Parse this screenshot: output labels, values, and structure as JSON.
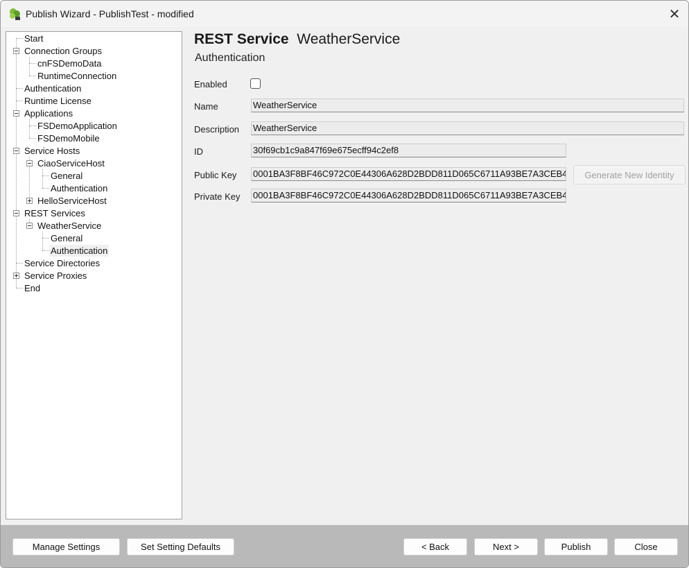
{
  "window": {
    "title": "Publish Wizard - PublishTest - modified",
    "close_glyph": "✕"
  },
  "tree": {
    "items": [
      {
        "label": "Start"
      },
      {
        "label": "Connection Groups"
      },
      {
        "label": "cnFSDemoData"
      },
      {
        "label": "RuntimeConnection"
      },
      {
        "label": "Authentication"
      },
      {
        "label": "Runtime License"
      },
      {
        "label": "Applications"
      },
      {
        "label": "FSDemoApplication"
      },
      {
        "label": "FSDemoMobile"
      },
      {
        "label": "Service Hosts"
      },
      {
        "label": "CiaoServiceHost"
      },
      {
        "label": "General"
      },
      {
        "label": "Authentication"
      },
      {
        "label": "HelloServiceHost"
      },
      {
        "label": "REST Services"
      },
      {
        "label": "WeatherService"
      },
      {
        "label": "General"
      },
      {
        "label": "Authentication"
      },
      {
        "label": "Service Directories"
      },
      {
        "label": "Service Proxies"
      },
      {
        "label": "End"
      }
    ],
    "selected": "Authentication"
  },
  "header": {
    "type": "REST Service",
    "name": "WeatherService",
    "subtitle": "Authentication"
  },
  "form": {
    "enabled_label": "Enabled",
    "name_label": "Name",
    "name_value": "WeatherService",
    "description_label": "Description",
    "description_value": "WeatherService",
    "id_label": "ID",
    "id_value": "30f69cb1c9a847f69e675ecff94c2ef8",
    "public_key_label": "Public Key",
    "public_key_value": "0001BA3F8BF46C972C0E44306A628D2BDD811D065C6711A93BE7A3CEB4",
    "private_key_label": "Private Key",
    "private_key_value": "0001BA3F8BF46C972C0E44306A628D2BDD811D065C6711A93BE7A3CEB4",
    "generate_button": "Generate New Identity"
  },
  "footer": {
    "manage_settings": "Manage Settings",
    "set_defaults": "Set Setting Defaults",
    "back": "< Back",
    "next": "Next >",
    "publish": "Publish",
    "close": "Close"
  }
}
